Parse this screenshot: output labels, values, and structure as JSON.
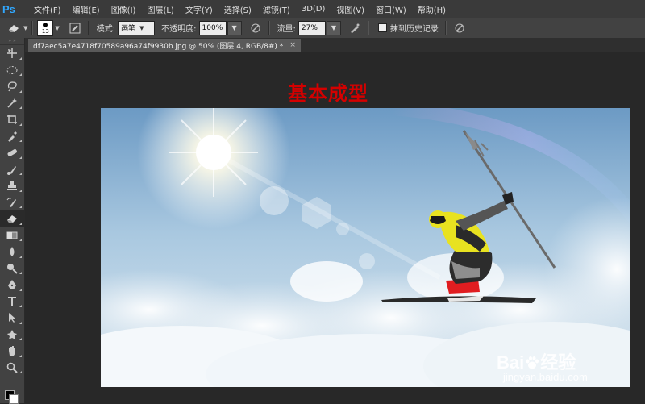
{
  "app": {
    "logo_text": "Ps"
  },
  "menu": [
    {
      "label": "文件(F)"
    },
    {
      "label": "编辑(E)"
    },
    {
      "label": "图像(I)"
    },
    {
      "label": "图层(L)"
    },
    {
      "label": "文字(Y)"
    },
    {
      "label": "选择(S)"
    },
    {
      "label": "滤镜(T)"
    },
    {
      "label": "3D(D)"
    },
    {
      "label": "视图(V)"
    },
    {
      "label": "窗口(W)"
    },
    {
      "label": "帮助(H)"
    }
  ],
  "options": {
    "brush_size": "13",
    "mode_label": "模式:",
    "mode_value": "画笔",
    "opacity_label": "不透明度:",
    "opacity_value": "100%",
    "flow_label": "流量:",
    "flow_value": "27%",
    "erase_history_label": "抹到历史记录",
    "erase_history_checked": false
  },
  "document": {
    "tab_title": "df7aec5a7e4718f70589a96a74f9930b.jpg @ 50% (图层 4, RGB/8#) *",
    "close_glyph": "×"
  },
  "canvas": {
    "heading": "基本成型"
  },
  "watermark": {
    "brand": "Bai",
    "brand_suffix": "经验",
    "url": "jingyan.baidu.com"
  },
  "colors": {
    "heading": "#d40000",
    "ps_blue": "#31a8ff",
    "foreground": "#000000",
    "background": "#ffffff"
  },
  "tools": [
    {
      "name": "move-tool",
      "icon": "move-icon"
    },
    {
      "name": "marquee-tool",
      "icon": "elliptical-marquee-icon"
    },
    {
      "name": "lasso-tool",
      "icon": "lasso-icon"
    },
    {
      "name": "magic-wand-tool",
      "icon": "magic-wand-icon"
    },
    {
      "name": "crop-tool",
      "icon": "crop-icon"
    },
    {
      "name": "eyedropper-tool",
      "icon": "eyedropper-icon"
    },
    {
      "name": "healing-brush-tool",
      "icon": "bandage-icon"
    },
    {
      "name": "brush-tool",
      "icon": "brush-icon"
    },
    {
      "name": "clone-stamp-tool",
      "icon": "stamp-icon"
    },
    {
      "name": "history-brush-tool",
      "icon": "history-brush-icon"
    },
    {
      "name": "eraser-tool",
      "icon": "eraser-icon",
      "active": true
    },
    {
      "name": "gradient-tool",
      "icon": "gradient-icon"
    },
    {
      "name": "blur-tool",
      "icon": "blur-icon"
    },
    {
      "name": "dodge-tool",
      "icon": "dodge-icon"
    },
    {
      "name": "pen-tool",
      "icon": "pen-icon"
    },
    {
      "name": "type-tool",
      "icon": "type-icon"
    },
    {
      "name": "path-selection-tool",
      "icon": "path-selection-icon"
    },
    {
      "name": "shape-tool",
      "icon": "shape-icon"
    },
    {
      "name": "hand-tool",
      "icon": "hand-icon"
    },
    {
      "name": "zoom-tool",
      "icon": "zoom-icon"
    }
  ]
}
